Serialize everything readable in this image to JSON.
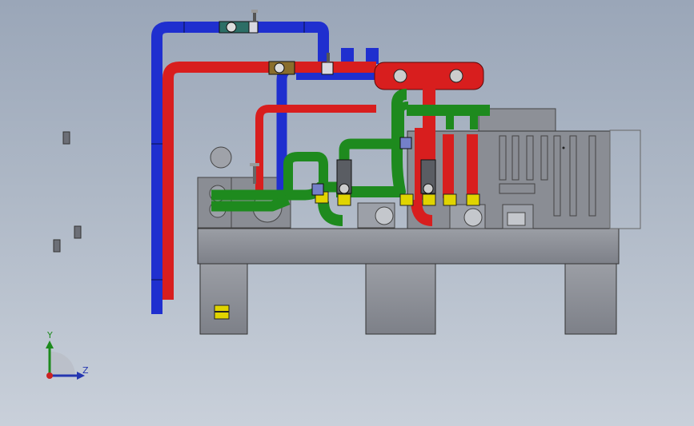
{
  "view": {
    "triad": {
      "y_label": "Y",
      "z_label": "Z"
    }
  },
  "colors": {
    "background_top": "#9aa6b8",
    "background_bottom": "#c9d0da",
    "hot_pipe": "#d81e1e",
    "cold_pipe": "#1f2fcf",
    "return_pipe": "#1e8a1e",
    "frame": "#8a8d94",
    "flange_yellow": "#e0d400"
  }
}
